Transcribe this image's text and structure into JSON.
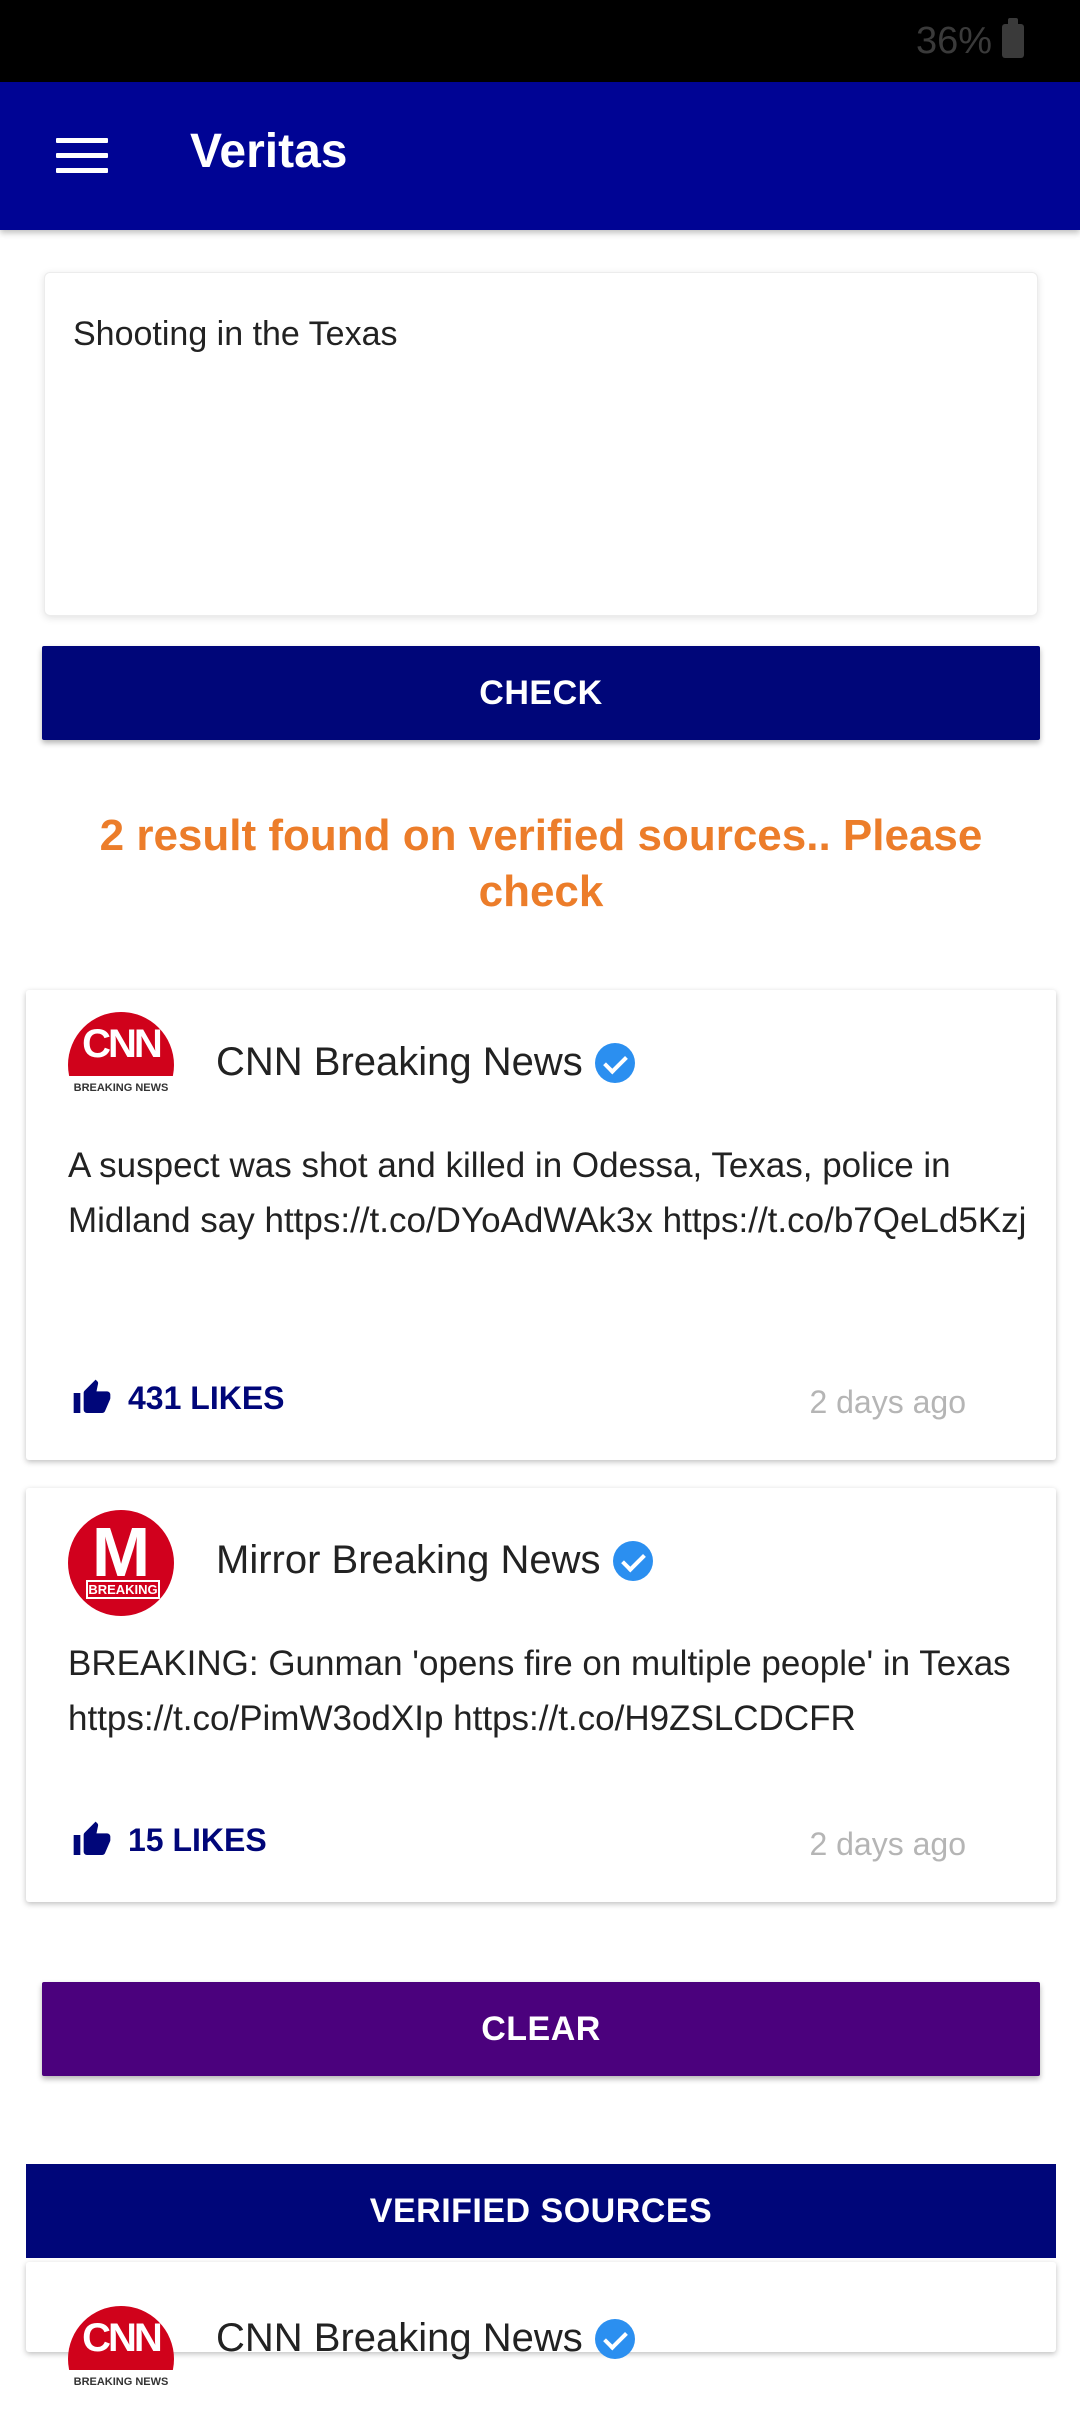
{
  "status_bar": {
    "battery": "36%"
  },
  "app_bar": {
    "title": "Veritas"
  },
  "query": {
    "text": "Shooting in the Texas"
  },
  "buttons": {
    "check": "CHECK",
    "clear": "CLEAR"
  },
  "result_message": "2 result found on verified sources.. Please check",
  "results": [
    {
      "source": "CNN Breaking News",
      "avatar": {
        "main": "CNN",
        "sub": "BREAKING NEWS"
      },
      "text": "A suspect was shot and killed in Odessa, Texas, police in Midland say https://t.co/DYoAdWAk3x https://t.co/b7QeLd5Kzj",
      "likes": "431 LIKES",
      "time": "2 days ago"
    },
    {
      "source": "Mirror Breaking News",
      "avatar": {
        "main": "M",
        "sub": "BREAKING"
      },
      "text": "BREAKING: Gunman 'opens fire on multiple people' in Texas https://t.co/PimW3odXIp https://t.co/H9ZSLCDCFR",
      "likes": "15 LIKES",
      "time": "2 days ago"
    }
  ],
  "verified_sources": {
    "header": "VERIFIED SOURCES",
    "items": [
      {
        "source": "CNN Breaking News",
        "avatar": {
          "main": "CNN",
          "sub": "BREAKING NEWS"
        }
      }
    ]
  },
  "colors": {
    "app_bar": "#000494",
    "check_button": "#000679",
    "clear_button": "#4b017d",
    "result_message": "#ec7d2a",
    "verified_badge": "#2b8ff0"
  }
}
